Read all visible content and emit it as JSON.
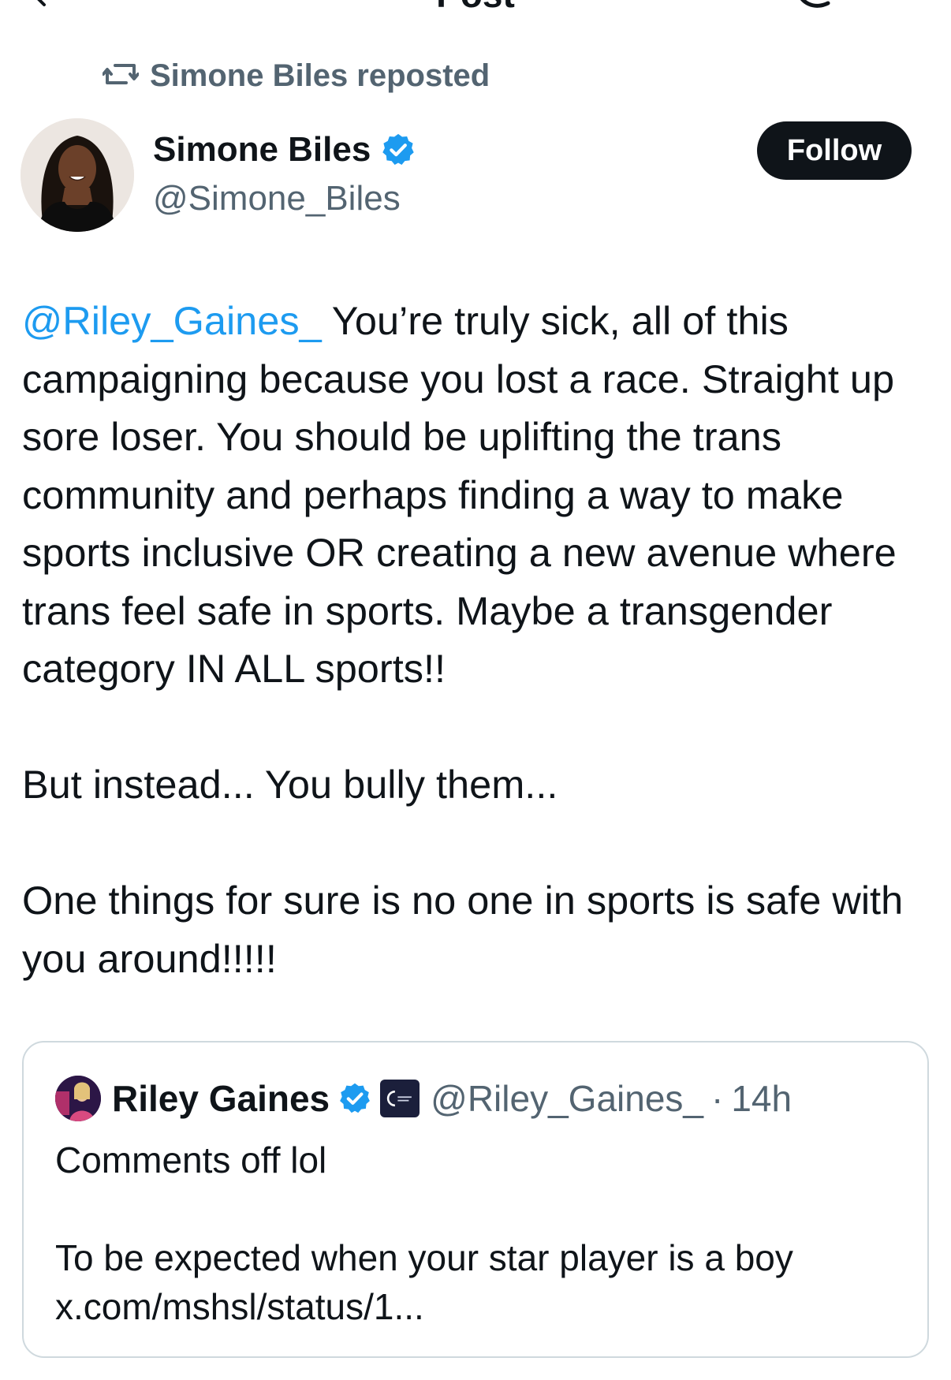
{
  "header": {
    "title": "Post"
  },
  "repost": {
    "text": "Simone Biles reposted"
  },
  "author": {
    "name": "Simone Biles",
    "handle": "@Simone_Biles",
    "follow_label": "Follow"
  },
  "post": {
    "mention": "@Riley_Gaines_",
    "paragraph1_rest": " You’re truly sick, all of this campaigning because you lost a race. Straight up sore loser. You should be uplifting the trans community and perhaps finding a way to make sports inclusive OR creating a new avenue where trans feel safe in sports. Maybe a transgender category IN ALL sports!!",
    "paragraph2": "But instead... You bully them...",
    "paragraph3": "One things for sure is no one in sports is safe with you around!!!!!"
  },
  "quoted_post": {
    "name": "Riley Gaines",
    "handle": "@Riley_Gaines_",
    "separator": "·",
    "time": "14h",
    "line1": "Comments off lol",
    "line2": "To be expected when your star player is a boy",
    "link": "x.com/mshsl/status/1..."
  },
  "colors": {
    "accent": "#1d9bf0",
    "text": "#0f1419",
    "secondary": "#536471",
    "border": "#cfd9de"
  },
  "icons": {
    "back": "arrow-left-icon",
    "reply": "reply-icon",
    "repost": "repost-icon",
    "verified": "verified-badge-icon",
    "affiliation": "affiliation-badge-icon"
  }
}
